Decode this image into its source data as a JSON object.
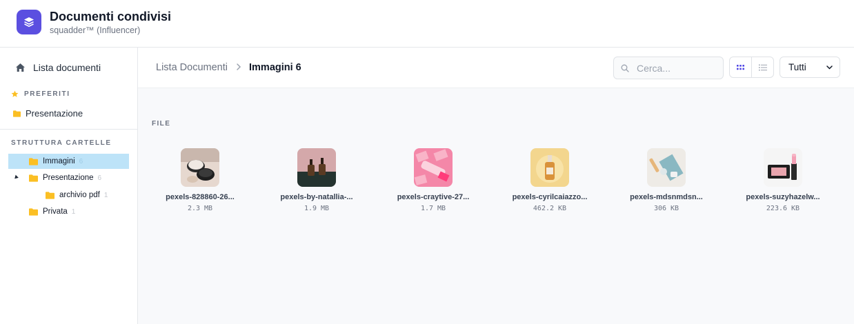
{
  "app": {
    "title": "Documenti condivisi",
    "subtitle": "squadder™ (Influencer)",
    "accent_color": "#5b4fe0"
  },
  "sidebar": {
    "home_label": "Lista documenti",
    "favorites_title": "PREFERITI",
    "favorites": [
      {
        "label": "Presentazione"
      }
    ],
    "tree_title": "STRUTTURA CARTELLE",
    "tree": [
      {
        "label": "Immagini",
        "count": "6",
        "selected": true
      },
      {
        "label": "Presentazione",
        "count": "6",
        "expanded": true
      },
      {
        "label": "archivio pdf",
        "count": "1"
      },
      {
        "label": "Privata",
        "count": "1"
      }
    ],
    "folder_color": "#fbbf24",
    "selected_color": "#bde3f8"
  },
  "breadcrumb": {
    "root": "Lista Documenti",
    "current": "Immagini 6"
  },
  "search": {
    "placeholder": "Cerca...",
    "value": ""
  },
  "filter": {
    "selected": "Tutti"
  },
  "files_section_label": "FILE",
  "files": [
    {
      "name": "pexels-828860-26...",
      "size": "2.3 MB",
      "thumb": "cosmetic-jars-icon"
    },
    {
      "name": "pexels-by-natallia-...",
      "size": "1.9 MB",
      "thumb": "serum-bottles-icon"
    },
    {
      "name": "pexels-craytive-27...",
      "size": "1.7 MB",
      "thumb": "pink-tubes-icon"
    },
    {
      "name": "pexels-cyrilcaiazzo...",
      "size": "462.2 KB",
      "thumb": "oil-bottle-icon"
    },
    {
      "name": "pexels-mdsnmdsn...",
      "size": "306 KB",
      "thumb": "skincare-set-icon"
    },
    {
      "name": "pexels-suzyhazelw...",
      "size": "223.6 KB",
      "thumb": "lipstick-palette-icon"
    }
  ]
}
